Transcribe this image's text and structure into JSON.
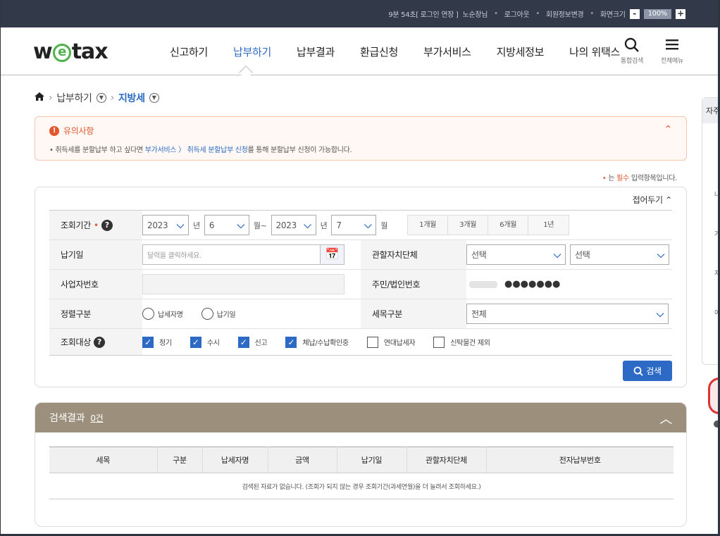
{
  "topbar": {
    "timer": "9분 54초[ 로그인 연장 ]",
    "user": "노순창님",
    "logout": "로그아웃",
    "member_edit": "회원정보변경",
    "screen_size": "화면크기",
    "zoom_minus": "-",
    "zoom_value": "100%",
    "zoom_plus": "+"
  },
  "header": {
    "logo_w": "w",
    "logo_e": "e",
    "logo_rest": "tax",
    "nav": [
      "신고하기",
      "납부하기",
      "납부결과",
      "환급신청",
      "부가서비스",
      "지방세정보",
      "나의 위택스"
    ],
    "search_label": "통합검색",
    "menu_label": "전체메뉴"
  },
  "breadcrumb": {
    "level1": "납부하기",
    "level2": "지방세"
  },
  "notice": {
    "title": "유의사항",
    "pre": "취득세를 분할납부 하고 싶다면 ",
    "link": "부가서비스 〉 취득세 분할납부 신청",
    "post": "를 통해 분할납부 신청이 가능합니다."
  },
  "required_note": {
    "mark": "•",
    "pre": " 는 ",
    "word": "필수",
    "post": " 입력항목입니다."
  },
  "form": {
    "fold_label": "접어두기",
    "period": {
      "label": "조회기간",
      "from_year": "2023",
      "year_unit": "년",
      "from_month": "6",
      "month_tilde": "월~",
      "to_year": "2023",
      "to_month": "7",
      "month_unit": "월",
      "quick": [
        "1개월",
        "3개월",
        "6개월",
        "1년"
      ]
    },
    "due_date": {
      "label": "납기일",
      "placeholder": "달력을 클릭하세요."
    },
    "authority": {
      "label": "관할자치단체",
      "sel1": "선택",
      "sel2": "선택"
    },
    "biz_no": {
      "label": "사업자번호",
      "value": ""
    },
    "id_no": {
      "label": "주민/법인번호",
      "masked": "●●●●●●●"
    },
    "sort": {
      "label": "정렬구분",
      "options": [
        "납세자명",
        "납기일"
      ]
    },
    "tax_item": {
      "label": "세목구분",
      "value": "전체"
    },
    "target": {
      "label": "조회대상",
      "options": [
        {
          "label": "정기",
          "checked": true
        },
        {
          "label": "수시",
          "checked": true
        },
        {
          "label": "신고",
          "checked": true
        },
        {
          "label": "체납/수납확인중",
          "checked": true
        },
        {
          "label": "연대납세자",
          "checked": false
        },
        {
          "label": "신탁물건 제외",
          "checked": false
        }
      ]
    },
    "search_button": "검색"
  },
  "result": {
    "title": "검색결과",
    "count": "0건",
    "columns": [
      "세목",
      "구분",
      "납세자명",
      "금액",
      "납기일",
      "관할자치단체",
      "전자납부번호"
    ],
    "empty": "검색된 자료가 없습니다. (조회가 되지 않는 경우 조회기간(과세연월)을 더 늘려서 조회하세요.)"
  },
  "side_panel": {
    "title": "자주",
    "items": [
      "나",
      "거",
      "지",
      "이"
    ]
  },
  "colors": {
    "accent": "#2c6ac6",
    "warning": "#e4572e",
    "result_header": "#9c907d",
    "topbar": "#323a4a"
  }
}
